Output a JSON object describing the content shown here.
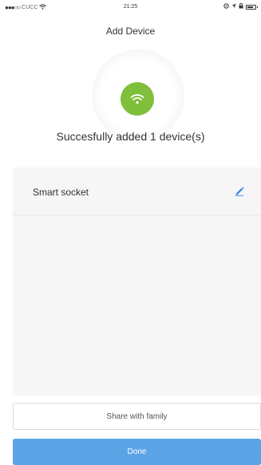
{
  "status_bar": {
    "signal_dots": "●●●○○",
    "carrier": "CUCC",
    "wifi_icon": "wifi-icon",
    "time": "21:25",
    "icons": [
      "location-icon",
      "lock-icon",
      "battery-icon"
    ]
  },
  "header": {
    "title": "Add Device"
  },
  "success": {
    "icon": "wifi-icon",
    "message": "Succesfully added 1 device(s)",
    "color": "#7fbf3b"
  },
  "devices": [
    {
      "name": "Smart socket",
      "action_icon": "pencil-icon"
    }
  ],
  "buttons": {
    "share_label": "Share with family",
    "done_label": "Done",
    "done_color": "#5aa4e6"
  },
  "colors": {
    "accent_blue": "#2f7fd8",
    "panel_bg": "#f6f6f7"
  }
}
